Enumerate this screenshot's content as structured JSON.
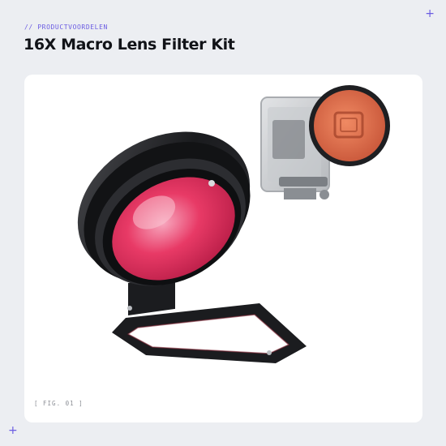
{
  "header": {
    "eyebrow": "// PRODUCTVOORDELEN",
    "title": "16X Macro Lens Filter Kit"
  },
  "figure": {
    "caption": "[ FIG. 01 ]",
    "image_alt": "macro lens with red filter and action camera housing with red filter"
  },
  "colors": {
    "accent": "#6a5be2",
    "background": "#eceef2",
    "card": "#ffffff",
    "title": "#111318",
    "filter_red": "#e83a66",
    "filter_orange": "#e0734e"
  },
  "icons": {
    "corner_top_right": "plus-icon",
    "corner_bottom_left": "plus-icon"
  }
}
